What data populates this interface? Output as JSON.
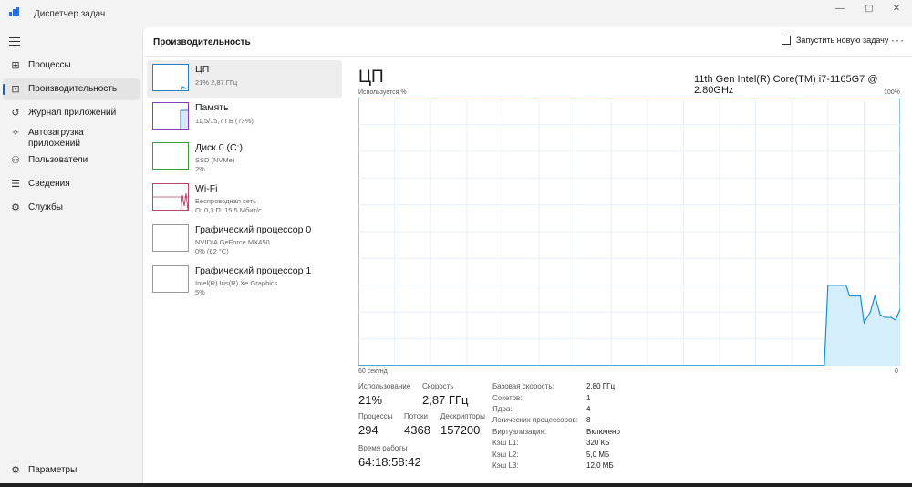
{
  "window": {
    "title": "Диспетчер задач",
    "minimize": "—",
    "maximize": "▢",
    "close": "✕"
  },
  "sidebar": {
    "items": [
      {
        "label": "Процессы",
        "icon": "processes-icon"
      },
      {
        "label": "Производительность",
        "icon": "performance-icon"
      },
      {
        "label": "Журнал приложений",
        "icon": "app-history-icon"
      },
      {
        "label": "Автозагрузка приложений",
        "icon": "startup-icon"
      },
      {
        "label": "Пользователи",
        "icon": "users-icon"
      },
      {
        "label": "Сведения",
        "icon": "details-icon"
      },
      {
        "label": "Службы",
        "icon": "services-icon"
      }
    ],
    "settings_label": "Параметры"
  },
  "header": {
    "title": "Производительность",
    "run_task_label": "Запустить новую задачу",
    "more": "···"
  },
  "resources": [
    {
      "name": "ЦП",
      "sub1": "21% 2,87 ГГц",
      "sub2": "",
      "sub3": ""
    },
    {
      "name": "Память",
      "sub1": "11,5/15,7 ГБ (73%)",
      "sub2": "",
      "sub3": ""
    },
    {
      "name": "Диск 0 (C:)",
      "sub1": "SSD (NVMe)",
      "sub2": "2%",
      "sub3": ""
    },
    {
      "name": "Wi-Fi",
      "sub1": "Беспроводная сеть",
      "sub2": "О: 0,3 П: 15,5 Мбит/с",
      "sub3": ""
    },
    {
      "name": "Графический процессор 0",
      "sub1": "NVIDIA GeForce MX450",
      "sub2": "0% (62 °C)",
      "sub3": ""
    },
    {
      "name": "Графический процессор 1",
      "sub1": "Intel(R) Iris(R) Xe Graphics",
      "sub2": "5%",
      "sub3": ""
    }
  ],
  "detail": {
    "title": "ЦП",
    "model": "11th Gen Intel(R) Core(TM) i7-1165G7 @ 2.80GHz",
    "usage_axis_label": "Используется %",
    "max_label": "100%",
    "time_label": "60 секунд",
    "min_label": "0"
  },
  "chart_data": {
    "type": "area",
    "title": "",
    "xlabel": "60 секунд",
    "ylabel": "Используется %",
    "xlim": [
      60,
      0
    ],
    "ylim": [
      0,
      100
    ],
    "grid": true,
    "color": "#1a8fd0",
    "fill": "#d5eefb",
    "x": [
      60,
      57,
      54,
      51,
      48,
      45,
      42,
      39,
      36,
      33,
      30,
      27,
      24,
      21,
      18,
      15,
      12,
      9,
      8.4,
      8,
      7,
      6,
      5.6,
      5,
      4.4,
      4,
      3.3,
      2.8,
      2.2,
      1.7,
      1,
      0.5,
      0
    ],
    "values": [
      0,
      0,
      0,
      0,
      0,
      0,
      0,
      0,
      0,
      0,
      0,
      0,
      0,
      0,
      0,
      0,
      0,
      0,
      0,
      30,
      30,
      30,
      26,
      26,
      26,
      16,
      20,
      26,
      19,
      18,
      18,
      17,
      21
    ]
  },
  "stats": {
    "usage_label": "Использование",
    "usage_value": "21%",
    "speed_label": "Скорость",
    "speed_value": "2,87 ГГц",
    "processes_label": "Процессы",
    "processes_value": "294",
    "threads_label": "Потоки",
    "threads_value": "4368",
    "handles_label": "Дескрипторы",
    "handles_value": "157200",
    "uptime_label": "Время работы",
    "uptime_value": "64:18:58:42"
  },
  "specs": [
    {
      "key": "Базовая скорость:",
      "value": "2,80 ГГц"
    },
    {
      "key": "Сокетов:",
      "value": "1"
    },
    {
      "key": "Ядра:",
      "value": "4"
    },
    {
      "key": "Логических процессоров:",
      "value": "8"
    },
    {
      "key": "Виртуализация:",
      "value": "Включено"
    },
    {
      "key": "Кэш L1:",
      "value": "320 КБ"
    },
    {
      "key": "Кэш L2:",
      "value": "5,0 МБ"
    },
    {
      "key": "Кэш L3:",
      "value": "12,0 МБ"
    }
  ],
  "colors": {
    "accent": "#1c5fb8",
    "cpu_line": "#1a8fd0",
    "memory": "#8a3fc0",
    "network": "#b34a6b"
  }
}
